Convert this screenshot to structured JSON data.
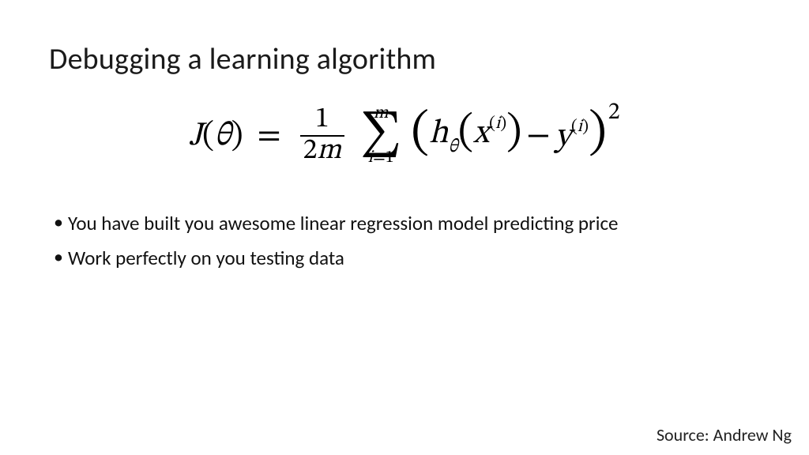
{
  "title": "Debugging a learning algorithm",
  "formula": {
    "lhs_func": "J",
    "lhs_arg": "θ",
    "frac_num": "1",
    "frac_den_coeff": "2",
    "frac_den_var": "m",
    "sum_top": "m",
    "sum_bottom_var": "i",
    "sum_bottom_eq": "=1",
    "h": "h",
    "h_sub": "θ",
    "x": "x",
    "idx_open": "(",
    "idx_i": "i",
    "idx_close": ")",
    "y": "y",
    "outer_power": "2"
  },
  "bullets": [
    "You have built you awesome linear regression model predicting price",
    "Work perfectly on you testing data"
  ],
  "source_label": "Source: Andrew Ng"
}
